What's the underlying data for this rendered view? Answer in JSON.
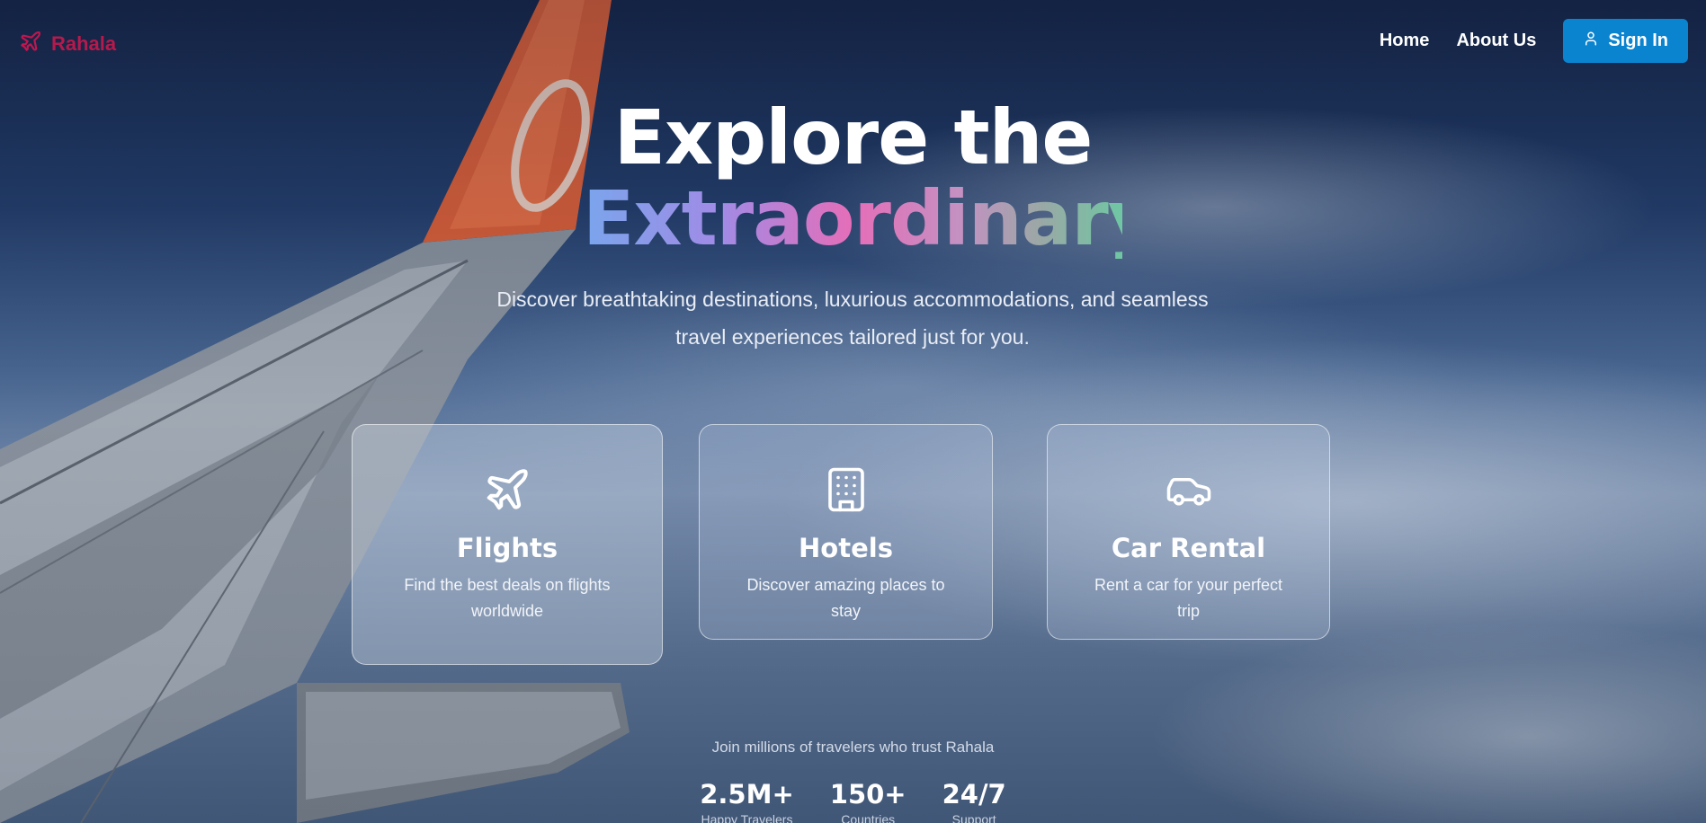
{
  "brand": {
    "name": "Rahala",
    "color": "#b51a4c",
    "icon": "plane-icon"
  },
  "nav": {
    "links": [
      "Home",
      "About Us"
    ],
    "signin_label": "Sign In",
    "signin_icon": "user-icon",
    "signin_color": "#0b84d0"
  },
  "hero": {
    "title_line1": "Explore the",
    "title_line2": "Extraordinary",
    "subtitle": "Discover breathtaking destinations, luxurious accommodations, and seamless travel experiences tailored just for you."
  },
  "services": [
    {
      "title": "Flights",
      "description": "Find the best deals on flights worldwide",
      "icon": "plane-icon"
    },
    {
      "title": "Hotels",
      "description": "Discover amazing places to stay",
      "icon": "building-icon"
    },
    {
      "title": "Car Rental",
      "description": "Rent a car for your perfect trip",
      "icon": "car-icon"
    }
  ],
  "trust": {
    "text": "Join millions of travelers who trust Rahala",
    "stats": [
      {
        "value": "2.5M+",
        "label": "Happy Travelers"
      },
      {
        "value": "150+",
        "label": "Countries"
      },
      {
        "value": "24/7",
        "label": "Support"
      }
    ]
  }
}
